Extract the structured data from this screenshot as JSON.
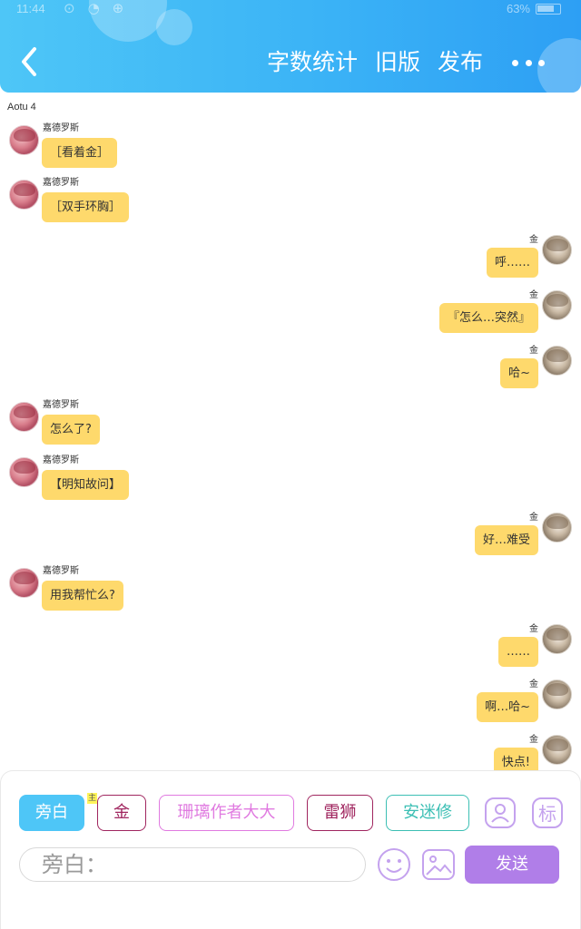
{
  "status_bar": {
    "time": "11:44",
    "battery": "63%"
  },
  "header": {
    "actions": [
      "字数统计",
      "旧版",
      "发布"
    ]
  },
  "chat": {
    "author": "Aotu 4",
    "messages": [
      {
        "side": "left",
        "name": "嘉德罗斯",
        "text": "［看着金］"
      },
      {
        "side": "left",
        "name": "嘉德罗斯",
        "text": "［双手环胸］"
      },
      {
        "side": "right",
        "name": "金",
        "text": "呼……"
      },
      {
        "side": "right",
        "name": "金",
        "text": "『怎么…突然』"
      },
      {
        "side": "right",
        "name": "金",
        "text": "哈~"
      },
      {
        "side": "left",
        "name": "嘉德罗斯",
        "text": "怎么了?"
      },
      {
        "side": "left",
        "name": "嘉德罗斯",
        "text": "【明知故问】"
      },
      {
        "side": "right",
        "name": "金",
        "text": "好…难受"
      },
      {
        "side": "left",
        "name": "嘉德罗斯",
        "text": "用我帮忙么?"
      },
      {
        "side": "right",
        "name": "金",
        "text": "……"
      },
      {
        "side": "right",
        "name": "金",
        "text": "啊…哈~"
      },
      {
        "side": "right",
        "name": "金",
        "text": "快点!"
      }
    ]
  },
  "panel": {
    "roles": [
      {
        "label": "旁白",
        "selected": true,
        "color": "#4ec6f7"
      },
      {
        "label": "金",
        "selected": false,
        "color": "#a0265f"
      },
      {
        "label": "珊璃作者大大",
        "selected": false,
        "color": "#e07ae0"
      },
      {
        "label": "雷狮",
        "selected": false,
        "color": "#a0265f"
      },
      {
        "label": "安迷修",
        "selected": false,
        "color": "#3cbfb4"
      }
    ],
    "narrator_tag": "主",
    "input_placeholder": "旁白：",
    "send_label": "发送",
    "accent": "#b07ee8"
  }
}
